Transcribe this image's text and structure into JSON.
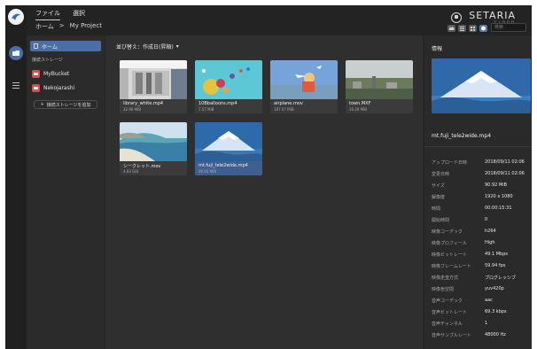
{
  "header": {
    "menu": [
      "ファイル",
      "選択"
    ],
    "breadcrumb": [
      "ホーム",
      ">",
      "My Project"
    ],
    "brand": {
      "name": "SETARIA",
      "sub": "CLOUD"
    },
    "search_placeholder": "検索"
  },
  "sidebar": {
    "home_label": "ホーム",
    "section_label": "接続ストレージ",
    "storages": [
      "MyBucket",
      "Nekojarashi"
    ],
    "add_storage_label": "接続ストレージを追加"
  },
  "main": {
    "sort_label": "並び替え：作成日(昇順)",
    "files": [
      {
        "name": "library_white.mp4",
        "size": "32.99 MiB"
      },
      {
        "name": "10Bballoons.mp4",
        "size": "7.57 MiB"
      },
      {
        "name": "airplane.mov",
        "size": "187.07 MiB"
      },
      {
        "name": "town.MXF",
        "size": "10.26 MiB"
      },
      {
        "name": "シークレット.mov",
        "size": "4.83 GiB"
      },
      {
        "name": "mt.fuji_tele2wide.mp4",
        "size": "90.92 MiB"
      }
    ]
  },
  "panel": {
    "title": "情報",
    "filename": "mt.fuji_tele2wide.mp4",
    "properties": [
      {
        "key": "アップロード日時",
        "value": "2018/09/11 02:06"
      },
      {
        "key": "変更日時",
        "value": "2018/09/11 02:06"
      },
      {
        "key": "サイズ",
        "value": "90.92 MiB"
      },
      {
        "key": "解像度",
        "value": "1920 x 1080"
      },
      {
        "key": "時間",
        "value": "00:00:15:31"
      },
      {
        "key": "開始時間",
        "value": "0"
      },
      {
        "key": "映像コーデック",
        "value": "h264"
      },
      {
        "key": "映像プロフィール",
        "value": "High"
      },
      {
        "key": "映像ビットレート",
        "value": "49.1 Mbps"
      },
      {
        "key": "映像フレームレート",
        "value": "59.94 fps"
      },
      {
        "key": "映像走査方式",
        "value": "プログレッシブ"
      },
      {
        "key": "映像色空間",
        "value": "yuv420p"
      },
      {
        "key": "音声コーデック",
        "value": "aac"
      },
      {
        "key": "音声ビットレート",
        "value": "69.3 kbps"
      },
      {
        "key": "音声チャンネル",
        "value": "1"
      },
      {
        "key": "音声サンプルレート",
        "value": "48000 Hz"
      }
    ]
  }
}
